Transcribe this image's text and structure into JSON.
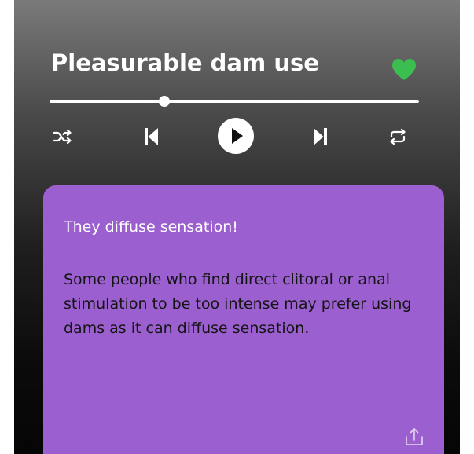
{
  "player": {
    "title": "Pleasurable dam use",
    "liked": true,
    "progress": 0.31,
    "colors": {
      "heart": "#3bbd4f",
      "accent": "#ffffff"
    },
    "controls": [
      "shuffle-icon",
      "previous-icon",
      "play-icon",
      "next-icon",
      "repeat-icon"
    ]
  },
  "card": {
    "heading": "They diffuse sensation!",
    "body": "Some people who find direct clitoral or anal stimulation to be too intense may prefer using dams as it can diffuse sensation.",
    "background": "#9b5fd0",
    "share_icon": "share-icon"
  }
}
